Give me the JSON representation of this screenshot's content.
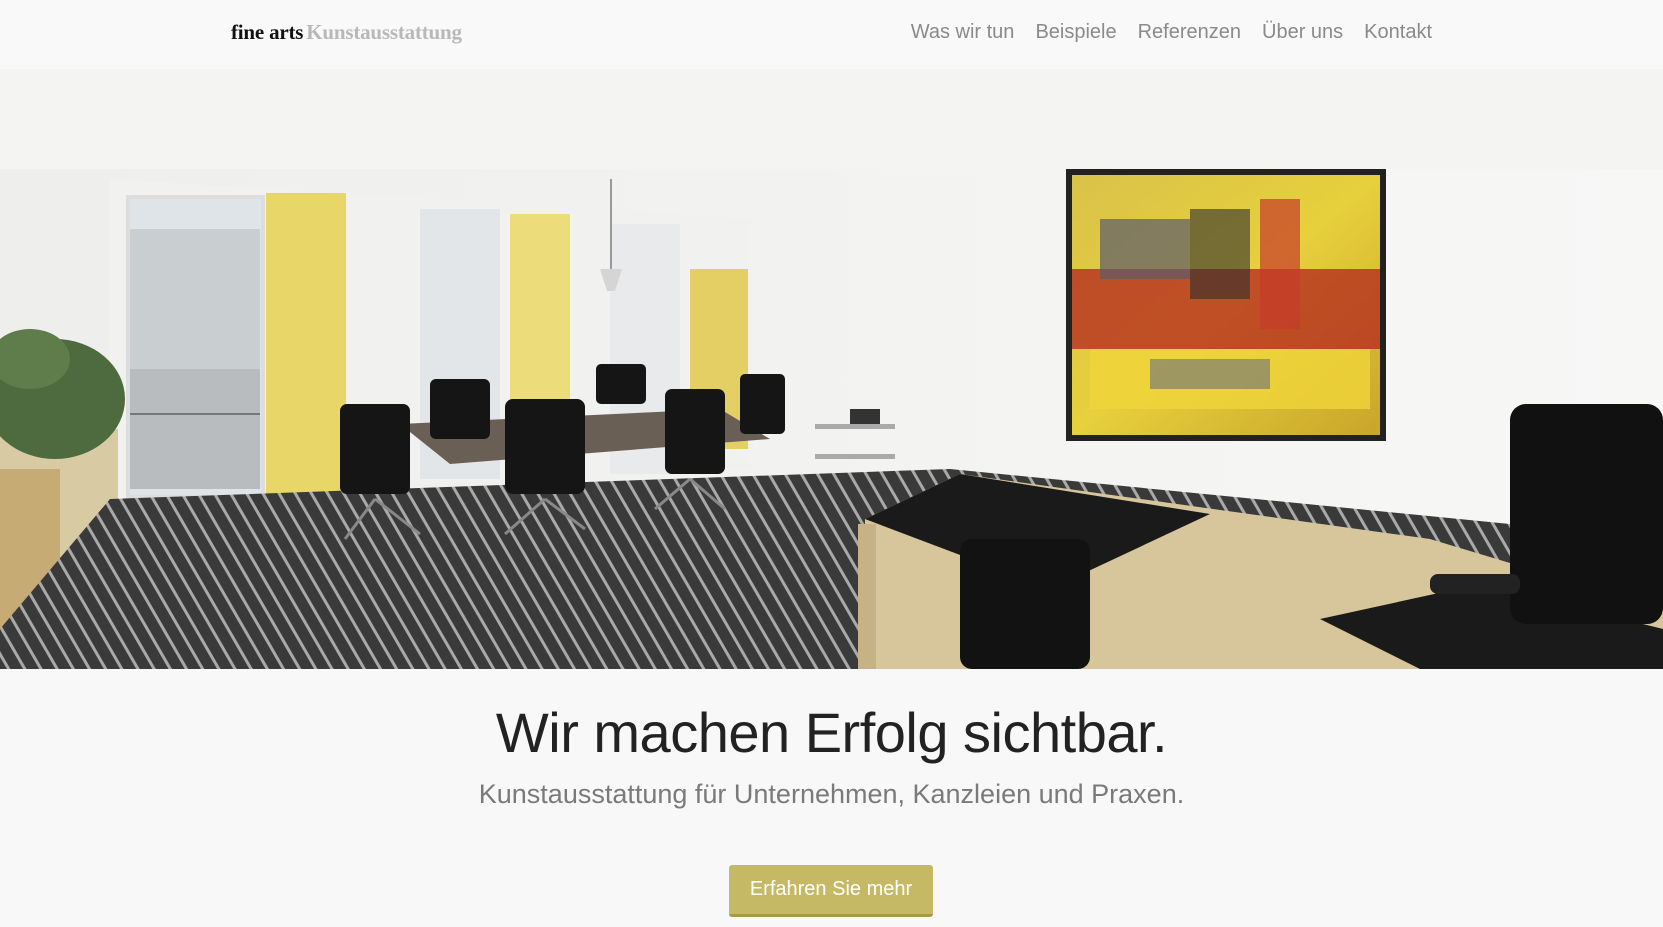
{
  "brand": {
    "name_strong": "fine arts",
    "name_light": "Kunstausstattung"
  },
  "nav": {
    "items": [
      {
        "label": "Was wir tun"
      },
      {
        "label": "Beispiele"
      },
      {
        "label": "Referenzen"
      },
      {
        "label": "Über uns"
      },
      {
        "label": "Kontakt"
      }
    ]
  },
  "hero": {
    "image": "office-conference-room-with-painting-photo"
  },
  "content": {
    "headline": "Wir machen Erfolg sichtbar.",
    "subline": "Kunstausstattung für Unternehmen, Kanzleien und Praxen.",
    "cta_label": "Erfahren Sie mehr"
  },
  "colors": {
    "accent": "#c6b965",
    "background": "#f8f8f8",
    "nav_text": "#8a8a8a"
  }
}
